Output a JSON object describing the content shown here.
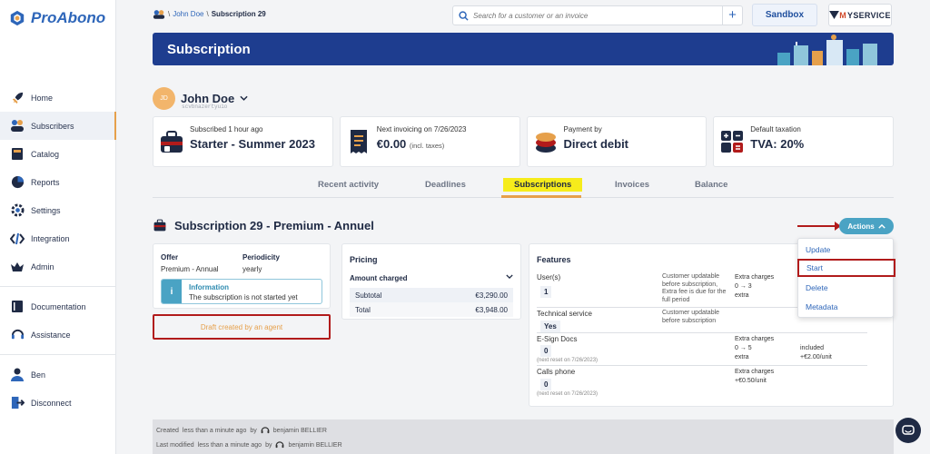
{
  "brand": {
    "name": "ProAbono",
    "color": "#2e66b9",
    "accent": "#e6a04b",
    "alert": "#b11b1b"
  },
  "sidebar": {
    "items": [
      {
        "label": "Home",
        "icon": "rocket-icon"
      },
      {
        "label": "Subscribers",
        "icon": "subscribers-icon"
      },
      {
        "label": "Catalog",
        "icon": "catalog-icon"
      },
      {
        "label": "Reports",
        "icon": "pie-chart-icon"
      },
      {
        "label": "Settings",
        "icon": "gear-icon"
      },
      {
        "label": "Integration",
        "icon": "code-icon"
      },
      {
        "label": "Admin",
        "icon": "crown-icon"
      },
      {
        "label": "Documentation",
        "icon": "book-icon"
      },
      {
        "label": "Assistance",
        "icon": "headset-icon"
      },
      {
        "label": "Ben",
        "icon": "user-icon"
      },
      {
        "label": "Disconnect",
        "icon": "logout-icon"
      }
    ]
  },
  "breadcrumb": {
    "sep1": "\\",
    "customer": "John Doe",
    "sep2": "\\",
    "current": "Subscription 29"
  },
  "search": {
    "placeholder": "Search for a customer or an invoice",
    "add": "+"
  },
  "header": {
    "sandbox": "Sandbox",
    "service_m": "M",
    "service": "YSERVICE"
  },
  "banner": {
    "title": "Subscription"
  },
  "customer": {
    "initials": "JD",
    "name": "John Doe",
    "id": "scvbnazertyuio"
  },
  "kpis": [
    {
      "label": "Subscribed 1 hour ago",
      "value": "Starter - Summer 2023",
      "sub": ""
    },
    {
      "label": "Next invoicing on 7/26/2023",
      "value": "€0.00",
      "sub": "(incl. taxes)"
    },
    {
      "label": "Payment by",
      "value": "Direct debit",
      "sub": ""
    },
    {
      "label": "Default taxation",
      "value": "TVA: 20%",
      "sub": ""
    }
  ],
  "tabs": [
    "Recent activity",
    "Deadlines",
    "Subscriptions",
    "Invoices",
    "Balance"
  ],
  "subscription": {
    "title": "Subscription 29 - Premium - Annuel",
    "actions": "Actions"
  },
  "offer": {
    "offer_label": "Offer",
    "offer_value": "Premium - Annual",
    "period_label": "Periodicity",
    "period_value": "yearly",
    "info_title": "Information",
    "info_text": "The subscription is not started yet",
    "draft": "Draft created by an agent"
  },
  "pricing": {
    "title": "Pricing",
    "amount_label": "Amount charged",
    "rows": [
      {
        "label": "Subtotal",
        "value": "€3,290.00"
      },
      {
        "label": "Total",
        "value": "€3,948.00"
      }
    ]
  },
  "features": {
    "title": "Features",
    "items": [
      {
        "name": "User(s)",
        "value": "1",
        "note": "",
        "desc": "Customer updatable before subscription, Extra fee is due for the full period",
        "extra": "Extra charges\n0 → 3\nextra",
        "extra2": ""
      },
      {
        "name": "Technical service",
        "value": "Yes",
        "note": "",
        "desc": "Customer updatable before subscription",
        "extra": "",
        "extra2": ""
      },
      {
        "name": "E-Sign Docs",
        "value": "0",
        "note": "(next reset on 7/26/2023)",
        "desc": "",
        "extra": "Extra charges\n0 → 5\nextra",
        "extra2": "\nincluded\n+€2.00/unit"
      },
      {
        "name": "Calls phone",
        "value": "0",
        "note": "(next reset on 7/26/2023)",
        "desc": "",
        "extra": "Extra charges\n+€0.50/unit",
        "extra2": ""
      }
    ]
  },
  "menu": {
    "items": [
      "Update",
      "Start",
      "Delete",
      "Metadata"
    ]
  },
  "footer": {
    "created_label": "Created",
    "created_time": "less than a minute ago",
    "by": "by",
    "created_user": "benjamin BELLIER",
    "modified_label": "Last modified",
    "modified_time": "less than a minute ago",
    "modified_user": "benjamin BELLIER"
  }
}
